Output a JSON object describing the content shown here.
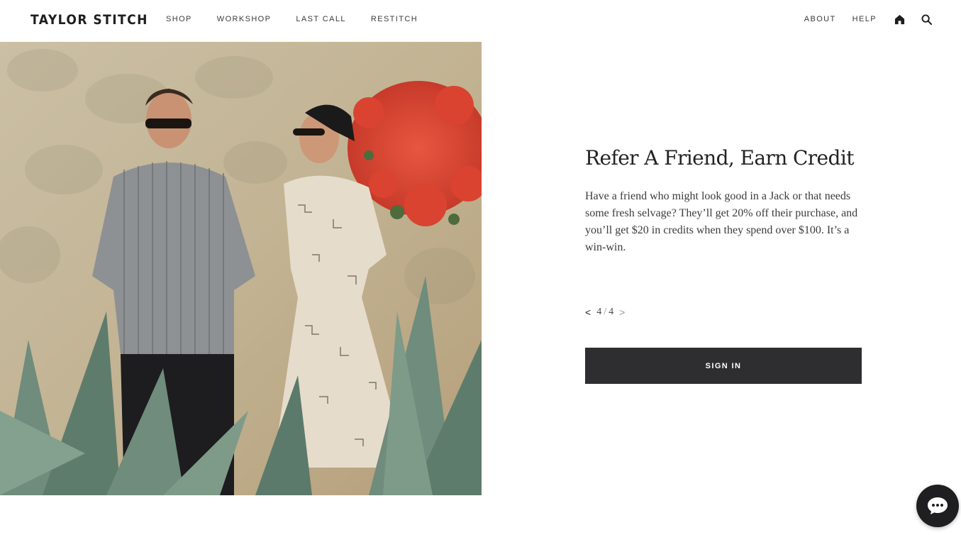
{
  "header": {
    "logo": "TAYLOR STITCH",
    "nav_left": [
      "SHOP",
      "WORKSHOP",
      "LAST CALL",
      "RESTITCH"
    ],
    "nav_right": [
      "ABOUT",
      "HELP"
    ],
    "icons": [
      "home-icon",
      "search-icon"
    ]
  },
  "hero": {
    "image": "couple-in-agave-field-photo"
  },
  "panel": {
    "title": "Refer A Friend, Earn Credit",
    "body": "Have a friend who might look good in a Jack or that needs some fresh selvage? They’ll get 20% off their purchase, and you’ll get $20 in credits when they spend over $100. It’s a win-win.",
    "pager": {
      "prev": "<",
      "current": "4",
      "separator": "/",
      "total": "4",
      "next": ">"
    },
    "signin_label": "SIGN IN"
  },
  "chat": {
    "icon": "chat-bubble-icon"
  },
  "colors": {
    "button_bg": "#2e2e30",
    "text": "#2b2b2d"
  }
}
